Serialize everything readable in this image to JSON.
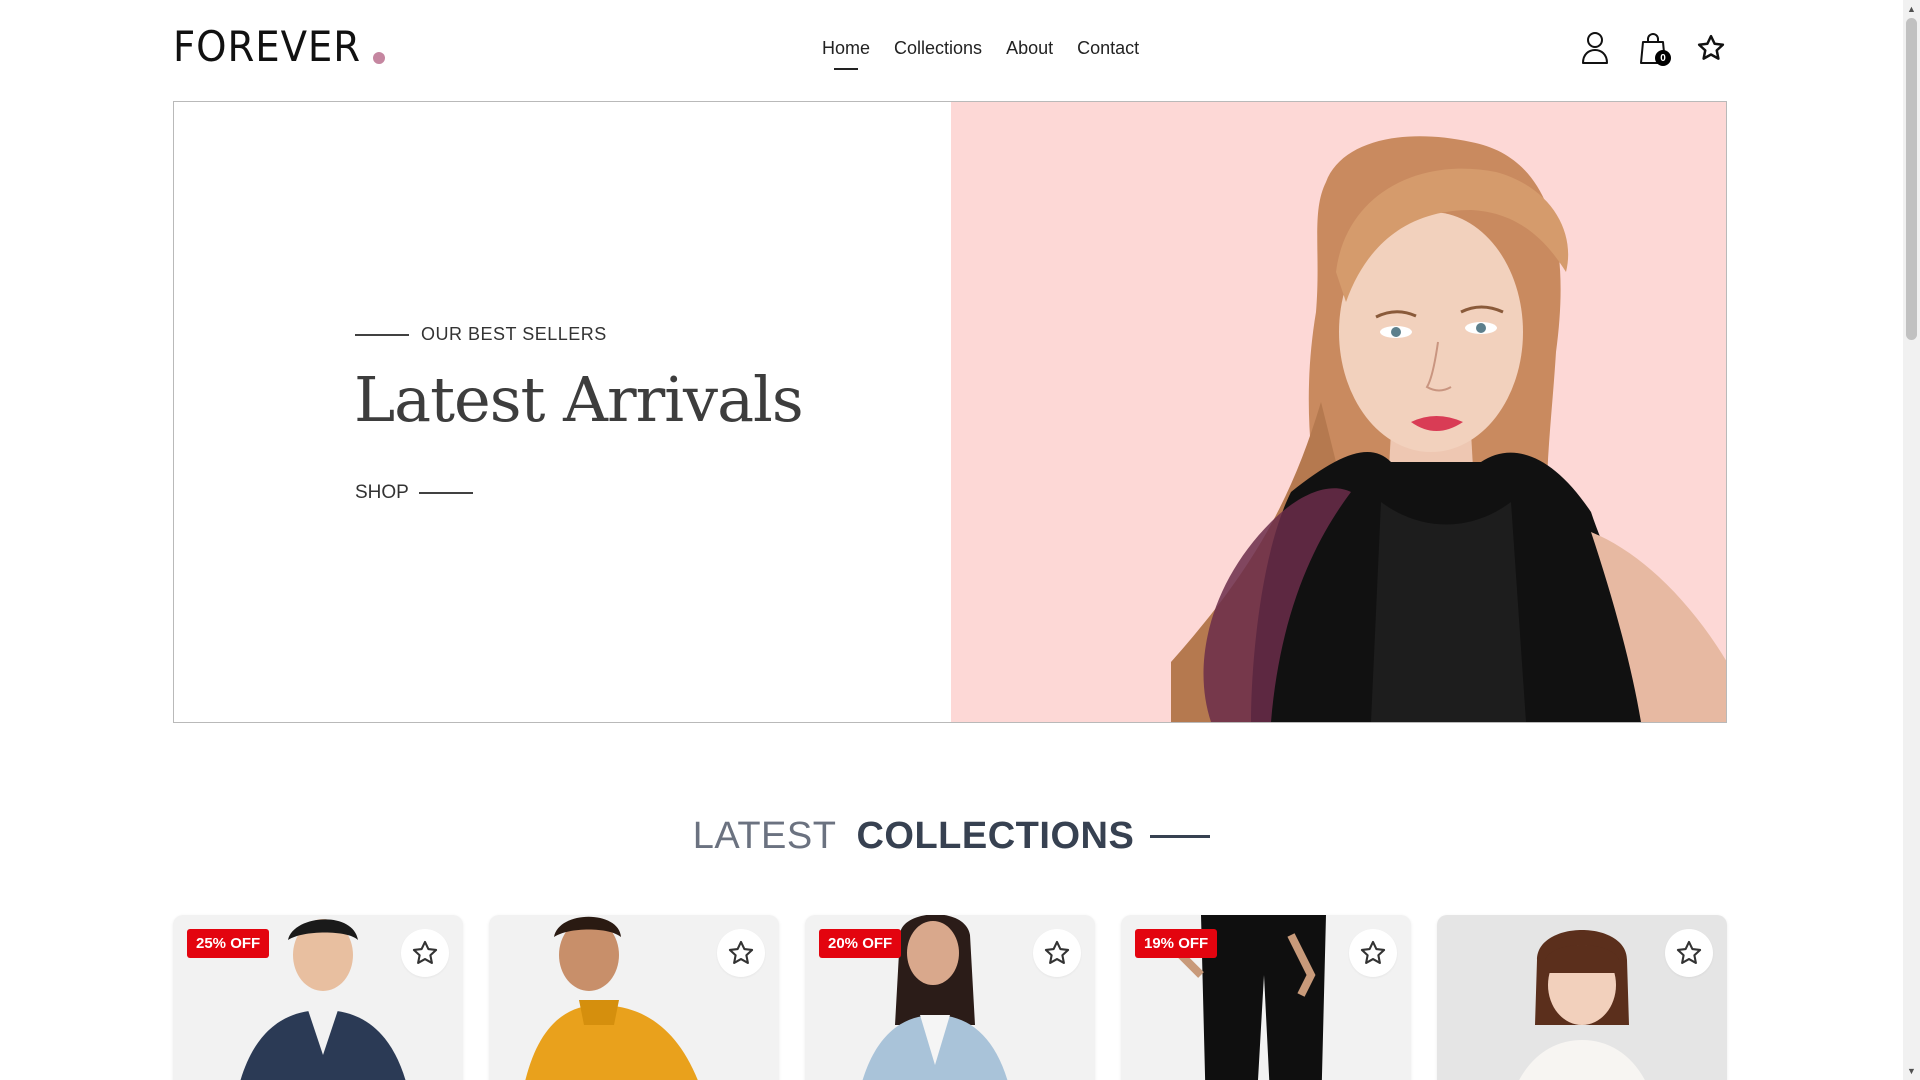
{
  "brand": {
    "logo_text": "FOREVER",
    "accent": "#c586a0"
  },
  "nav": {
    "items": [
      {
        "label": "Home",
        "active": true
      },
      {
        "label": "Collections",
        "active": false
      },
      {
        "label": "About",
        "active": false
      },
      {
        "label": "Contact",
        "active": false
      }
    ]
  },
  "header_icons": {
    "profile": "user-icon",
    "cart": "shopping-bag-icon",
    "cart_count": "0",
    "wishlist": "star-icon"
  },
  "hero": {
    "eyebrow": "OUR BEST SELLERS",
    "title": "Latest Arrivals",
    "cta": "SHOP",
    "bg_color": "#fdd8d6"
  },
  "section": {
    "title_light": "LATEST",
    "title_bold": "COLLECTIONS"
  },
  "products": [
    {
      "badge": "25% OFF",
      "fav_icon": "star-icon"
    },
    {
      "badge": "",
      "fav_icon": "star-icon"
    },
    {
      "badge": "20% OFF",
      "fav_icon": "star-icon"
    },
    {
      "badge": "19% OFF",
      "fav_icon": "star-icon"
    },
    {
      "badge": "",
      "fav_icon": "star-icon"
    }
  ],
  "colors": {
    "badge": "#e3040f",
    "text_dark": "#374151",
    "text_muted": "#6b7280"
  }
}
